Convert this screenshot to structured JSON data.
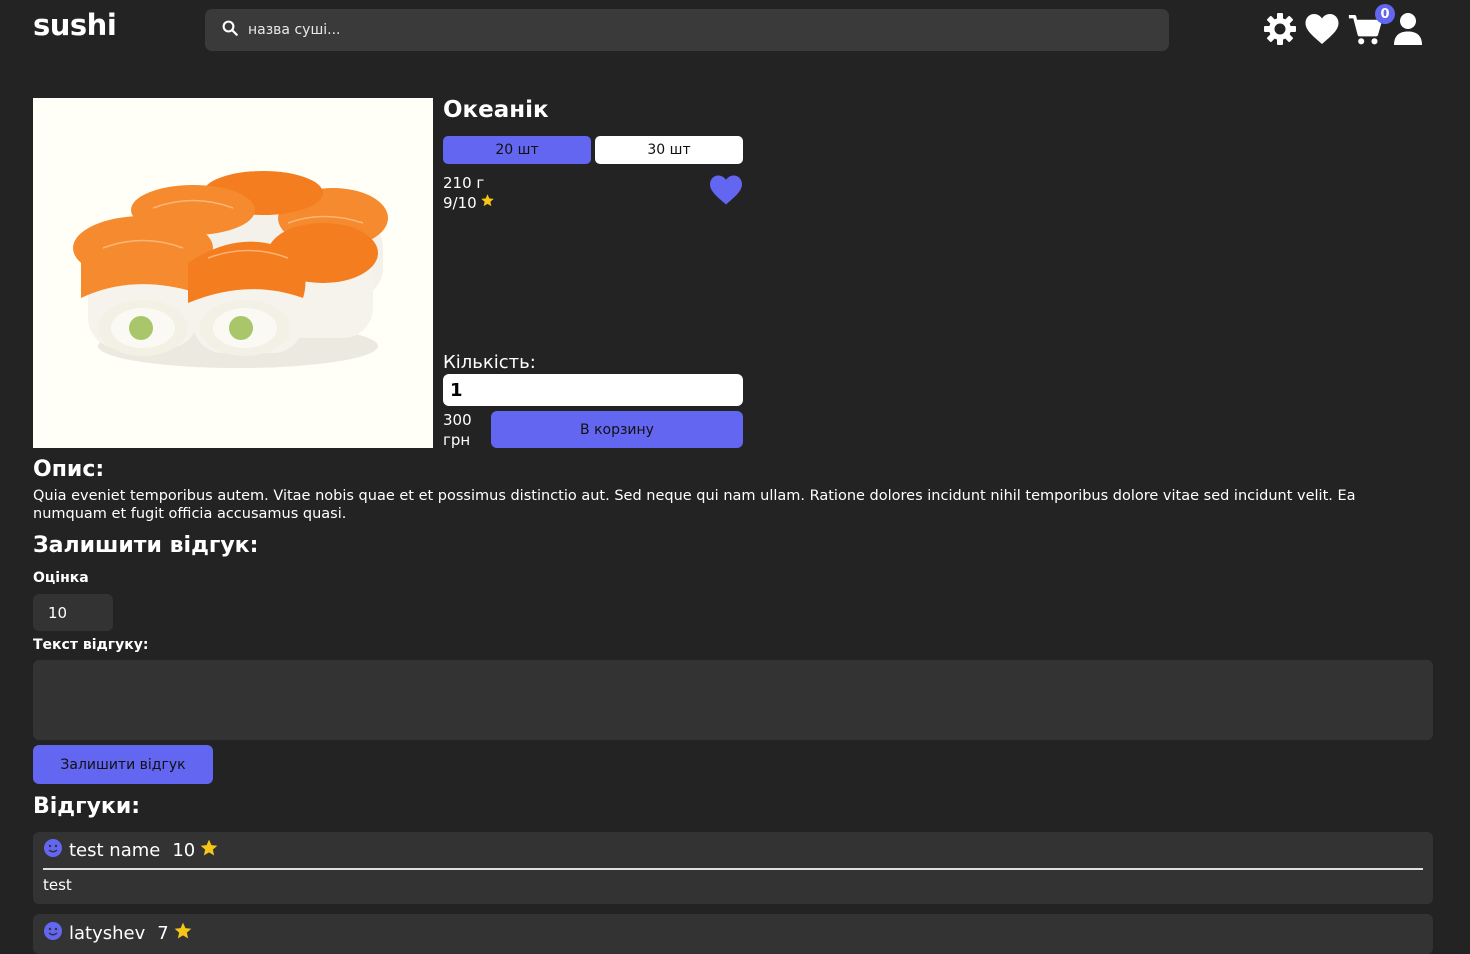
{
  "header": {
    "logo": "sushi",
    "search_placeholder": "назва суші...",
    "cart_count": "0",
    "icons": [
      "search-icon",
      "settings-icon",
      "heart-icon",
      "cart-icon",
      "user-icon"
    ]
  },
  "product": {
    "title": "Океанік",
    "sizes": [
      {
        "label": "20 шт",
        "active": true
      },
      {
        "label": "30 шт",
        "active": false
      }
    ],
    "weight": "210 г",
    "rating": "9/10",
    "quantity_label": "Кількість:",
    "quantity_value": "1",
    "price": "300 грн",
    "add_to_cart_label": "В корзину"
  },
  "description": {
    "heading": "Опис:",
    "text": "Quia eveniet temporibus autem. Vitae nobis quae et et possimus distinctio aut. Sed neque qui nam ullam. Ratione dolores incidunt nihil temporibus dolore vitae sed incidunt velit. Ea numquam et fugit officia accusamus quasi."
  },
  "review_form": {
    "heading": "Залишити відгук:",
    "score_label": "Оцінка",
    "score_value": "10",
    "text_label": "Текст відгуку:",
    "text_value": "",
    "submit_label": "Залишити відгук"
  },
  "reviews": {
    "heading": "Відгуки:",
    "items": [
      {
        "name": "test name",
        "score": "10",
        "text": "test"
      },
      {
        "name": "latyshev",
        "score": "7",
        "text": ""
      }
    ]
  },
  "colors": {
    "background": "#232323",
    "accent": "#6366f1",
    "star": "#f5c518",
    "input_bg": "#333333"
  }
}
